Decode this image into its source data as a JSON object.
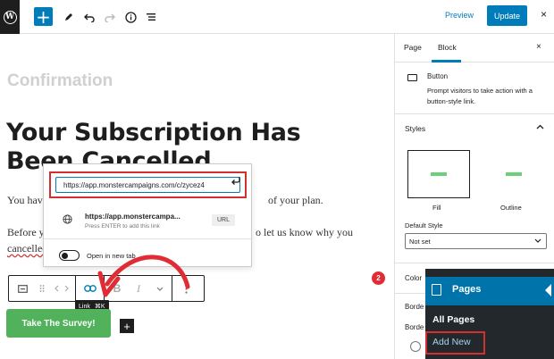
{
  "topbar": {
    "logo": "W",
    "add_icon": "+",
    "tools_icon": "pencil-icon",
    "undo_icon": "undo-icon",
    "redo_icon": "redo-icon",
    "info_icon": "info-icon",
    "outline_icon": "list-view-icon",
    "preview_label": "Preview",
    "update_label": "Update",
    "close_icon": "×"
  },
  "editor": {
    "confirmation": "Confirmation",
    "heading": "Your Subscription Has Been Cancelled",
    "para1_start": "You have",
    "para1_end": "of your plan.",
    "para2_start": "Before y",
    "para2_end": "o let us know why you",
    "para3": "cancelled"
  },
  "block_toolbar": {
    "icons": [
      "button-block-icon",
      "move-icon",
      "link-icon",
      "bold-icon",
      "italic-icon",
      "more-icon",
      "options-icon"
    ],
    "bold": "B",
    "italic": "I",
    "tooltip_label": "Link",
    "tooltip_shortcut": "⌘K"
  },
  "link_popover": {
    "url_value": "https://app.monstercampaigns.com/c/zycez4",
    "suggestion_url": "https://app.monstercampa...",
    "suggestion_hint": "Press ENTER to add this link",
    "suggestion_type": "URL",
    "new_tab_label": "Open in new tab"
  },
  "button_label": "Take The Survey!",
  "callout_number": "2",
  "sidebar": {
    "tab_page": "Page",
    "tab_block": "Block",
    "close": "×",
    "block_title": "Button",
    "block_desc": "Prompt visitors to take action with a button-style link.",
    "styles_title": "Styles",
    "styles_chevron": "^",
    "style_fill": "Fill",
    "style_outline": "Outline",
    "default_style_label": "Default Style",
    "default_style_value": "Not set",
    "color_label": "Color",
    "border_label_1": "Borde",
    "border_label_2": "Borde"
  },
  "wp_menu": {
    "pages": "Pages",
    "all_pages": "All Pages",
    "add_new": "Add New"
  },
  "colors": {
    "accent": "#007cba",
    "button_green": "#52b25b",
    "highlight_red": "#d32f2f",
    "wp_admin_dark": "#23282d",
    "wp_admin_blue": "#0073aa"
  }
}
